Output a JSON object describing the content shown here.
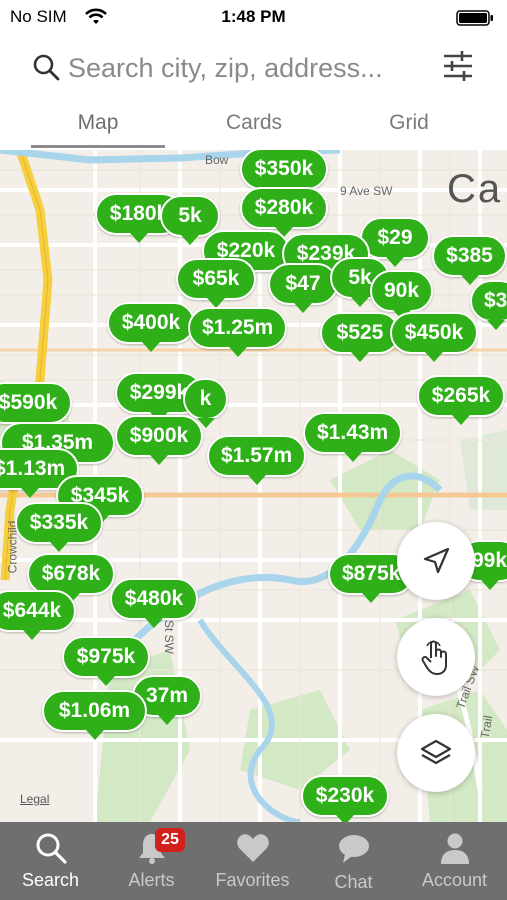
{
  "status_bar": {
    "carrier": "No SIM",
    "time": "1:48 PM"
  },
  "search": {
    "placeholder": "Search city, zip, address..."
  },
  "tabs": [
    {
      "label": "Map",
      "active": true
    },
    {
      "label": "Cards",
      "active": false
    },
    {
      "label": "Grid",
      "active": false
    }
  ],
  "map": {
    "city_label": "Ca",
    "street_labels": [
      "Bow",
      "9 Ave SW",
      "Crowchild",
      "Trail SW",
      "St SW",
      "Trail"
    ],
    "legal": "Legal"
  },
  "pins": [
    "$350k",
    "$180k",
    "5k",
    "$280k",
    "$29",
    "$220k",
    "$239k",
    "$385",
    "$65k",
    "$47",
    "5k",
    "90k",
    "$3",
    "$400k",
    "$1.25m",
    "$525",
    "$450k",
    "$299k",
    "k",
    "$265k",
    "$590k",
    "$1.35m",
    "$900k",
    "$1.43m",
    "$1.13m",
    "$1.57m",
    "$345k",
    "$335k",
    "$678k",
    "$875k",
    "99k",
    "$644k",
    "$480k",
    "$975k",
    "37m",
    "$1.06m",
    "$230k"
  ],
  "bottom_nav": [
    {
      "label": "Search",
      "icon": "search-icon",
      "active": true
    },
    {
      "label": "Alerts",
      "icon": "bell-icon",
      "active": false,
      "badge": "25"
    },
    {
      "label": "Favorites",
      "icon": "heart-icon",
      "active": false
    },
    {
      "label": "Chat",
      "icon": "chat-icon",
      "active": false
    },
    {
      "label": "Account",
      "icon": "person-icon",
      "active": false
    }
  ],
  "colors": {
    "pin_green": "#2fb019",
    "nav_background": "#6f6f6f",
    "badge_red": "#d0211c",
    "map_background": "#f3efe8",
    "park_green": "#d3e8c4",
    "river_blue": "#a8d4ec",
    "highway_yellow": "#f5cf3f"
  }
}
